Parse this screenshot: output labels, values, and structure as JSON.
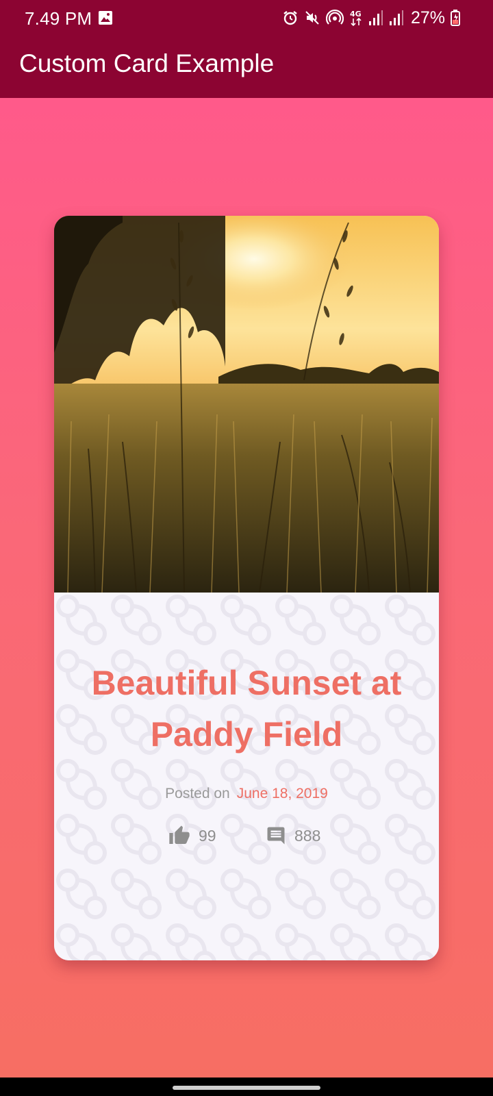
{
  "status_bar": {
    "time": "7.49 PM",
    "battery": "27%",
    "icons": [
      "gallery-icon",
      "alarm-icon",
      "mute-icon",
      "hotspot-icon",
      "4g-icon",
      "signal-icon",
      "signal-icon",
      "battery-charging-icon"
    ]
  },
  "app_bar": {
    "title": "Custom Card Example",
    "color": "#8c0432"
  },
  "card": {
    "image": "sunset-field-photo",
    "title": "Beautiful Sunset at Paddy Field",
    "posted_label": "Posted on",
    "posted_date": "June 18, 2019",
    "likes": "99",
    "comments": "888",
    "accent_color": "#ee6f64"
  },
  "colors": {
    "gradient_top": "#ff5a8a",
    "gradient_bottom": "#f76e63"
  }
}
